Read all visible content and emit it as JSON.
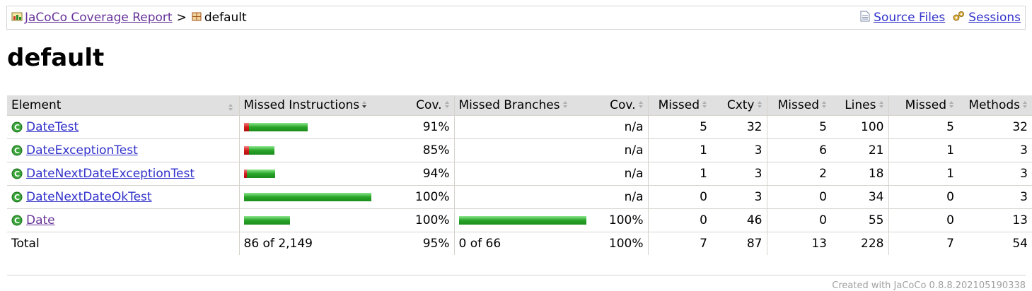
{
  "breadcrumb": {
    "report_link": "JaCoCo Coverage Report",
    "separator": ">",
    "current": "default",
    "source_files_link": "Source Files",
    "sessions_link": "Sessions"
  },
  "page_title": "default",
  "table": {
    "headers": {
      "element": "Element",
      "missed_instructions": "Missed Instructions",
      "instr_cov": "Cov.",
      "missed_branches": "Missed Branches",
      "branch_cov": "Cov.",
      "missed_cxty": "Missed",
      "cxty": "Cxty",
      "missed_lines": "Missed",
      "lines": "Lines",
      "missed_methods": "Missed",
      "methods": "Methods"
    },
    "rows": [
      {
        "name": "DateTest",
        "visited": false,
        "instr_red": 0.04,
        "instr_green": 0.46,
        "instr_cov": "91%",
        "branch_green": 0,
        "branch_cov": "n/a",
        "missed_cxty": "5",
        "cxty": "32",
        "missed_lines": "5",
        "lines": "100",
        "missed_methods": "5",
        "methods": "32"
      },
      {
        "name": "DateExceptionTest",
        "visited": false,
        "instr_red": 0.04,
        "instr_green": 0.2,
        "instr_cov": "85%",
        "branch_green": 0,
        "branch_cov": "n/a",
        "missed_cxty": "1",
        "cxty": "3",
        "missed_lines": "6",
        "lines": "21",
        "missed_methods": "1",
        "methods": "3"
      },
      {
        "name": "DateNextDateExceptionTest",
        "visited": false,
        "instr_red": 0.01,
        "instr_green": 0.22,
        "instr_cov": "94%",
        "branch_green": 0,
        "branch_cov": "n/a",
        "missed_cxty": "1",
        "cxty": "3",
        "missed_lines": "2",
        "lines": "18",
        "missed_methods": "1",
        "methods": "3"
      },
      {
        "name": "DateNextDateOkTest",
        "visited": false,
        "instr_red": 0,
        "instr_green": 1.0,
        "instr_cov": "100%",
        "branch_green": 0,
        "branch_cov": "n/a",
        "missed_cxty": "0",
        "cxty": "3",
        "missed_lines": "0",
        "lines": "34",
        "missed_methods": "0",
        "methods": "3"
      },
      {
        "name": "Date",
        "visited": true,
        "instr_red": 0,
        "instr_green": 0.36,
        "instr_cov": "100%",
        "branch_green": 1.0,
        "branch_cov": "100%",
        "missed_cxty": "0",
        "cxty": "46",
        "missed_lines": "0",
        "lines": "55",
        "missed_methods": "0",
        "methods": "13"
      }
    ],
    "total": {
      "label": "Total",
      "missed_instructions": "86 of 2,149",
      "instr_cov": "95%",
      "missed_branches": "0 of 66",
      "branch_cov": "100%",
      "missed_cxty": "7",
      "cxty": "87",
      "missed_lines": "13",
      "lines": "228",
      "missed_methods": "7",
      "methods": "54"
    }
  },
  "footer": "Created with JaCoCo 0.8.8.202105190338",
  "colors": {
    "link": "#3333cc",
    "visited_link": "#663399",
    "header_bg": "#e0e0e0",
    "bar_green": "#28a428",
    "bar_red": "#d41c1c"
  }
}
